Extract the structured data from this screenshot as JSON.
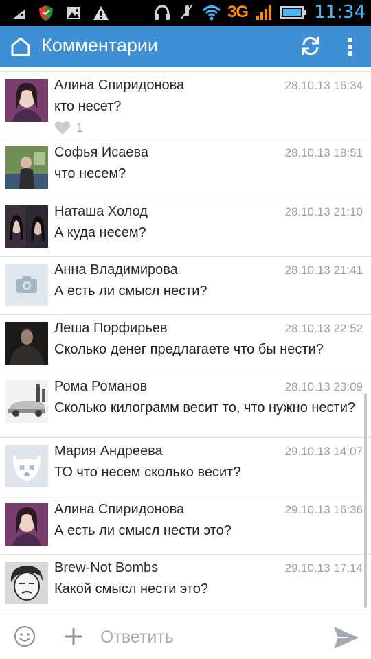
{
  "status_bar": {
    "network": "3G",
    "time": "11:34",
    "icons": [
      "android-icon",
      "shield-icon",
      "image-icon",
      "warning-icon",
      "headphones-icon",
      "mute-icon",
      "wifi-icon",
      "signal-icon",
      "battery-icon"
    ]
  },
  "header": {
    "title": "Комментарии",
    "icons": [
      "home-icon",
      "refresh-icon",
      "overflow-menu-icon"
    ]
  },
  "comments": [
    {
      "author": "Алина Спиридонова",
      "date": "28.10.13 16:34",
      "text": "кто несет?",
      "likes": "1"
    },
    {
      "author": "Софья Исаева",
      "date": "28.10.13 18:51",
      "text": "что несем?"
    },
    {
      "author": "Наташа Холод",
      "date": "28.10.13 21:10",
      "text": "А куда несем?"
    },
    {
      "author": "Анна Владимирова",
      "date": "28.10.13 21:41",
      "text": "А есть ли смысл нести?"
    },
    {
      "author": "Леша Порфирьев",
      "date": "28.10.13 22:52",
      "text": "Сколько денег предлагаете что бы нести?"
    },
    {
      "author": "Рома Романов",
      "date": "28.10.13 23:09",
      "text": "Сколько килограмм весит то, что нужно нести?"
    },
    {
      "author": "Мария Андреева",
      "date": "29.10.13 14:07",
      "text": "ТО что несем сколько весит?"
    },
    {
      "author": "Алина Спиридонова",
      "date": "29.10.13 16:36",
      "text": "А есть ли смысл нести это?"
    },
    {
      "author": "Brew-Not Bombs",
      "date": "29.10.13 17:14",
      "text": "Какой смысл нести это?"
    }
  ],
  "composer": {
    "placeholder": "Ответить",
    "value": ""
  },
  "colors": {
    "action_bar": "#3f8fd5",
    "network_3g": "#ff8a00",
    "clock": "#3fb7ff",
    "date_text": "#9aa0a6",
    "divider": "#dde3ea"
  }
}
